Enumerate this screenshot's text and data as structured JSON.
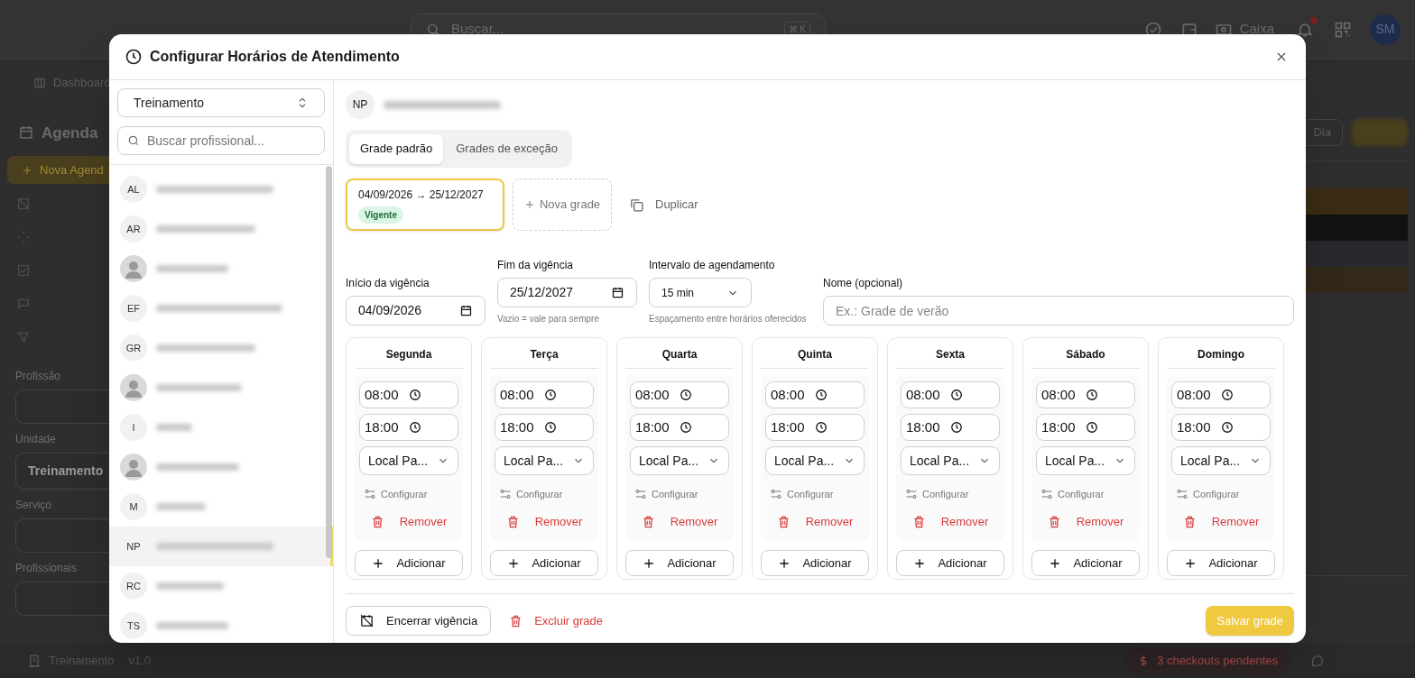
{
  "app": {
    "search_placeholder": "Buscar...",
    "search_shortcut": "⌘ K",
    "cash_label": "Caixa",
    "user_initials": "SM",
    "breadcrumb": "Dashboard",
    "page_title": "Agenda",
    "new_button": "Nova Agend",
    "view_button": "Dia",
    "filters": [
      {
        "label": "Profissão"
      },
      {
        "label": "Unidade",
        "value": "Treinamento"
      },
      {
        "label": "Serviço"
      },
      {
        "label": "Profissionais"
      }
    ],
    "footer": {
      "unit": "Treinamento",
      "version": "v1.0",
      "checkouts": "3 checkouts pendentes"
    }
  },
  "modal": {
    "title": "Configurar Horários de Atendimento",
    "unit_select": "Treinamento",
    "search_placeholder": "Buscar profissional...",
    "professionals": [
      {
        "kind": "initials",
        "initials": "AL",
        "selected": false
      },
      {
        "kind": "initials",
        "initials": "AR",
        "selected": false
      },
      {
        "kind": "photo",
        "selected": false
      },
      {
        "kind": "initials",
        "initials": "EF",
        "selected": false
      },
      {
        "kind": "initials",
        "initials": "GR",
        "selected": false
      },
      {
        "kind": "photo",
        "selected": false
      },
      {
        "kind": "initials",
        "initials": "I",
        "selected": false
      },
      {
        "kind": "photo",
        "selected": false
      },
      {
        "kind": "initials",
        "initials": "M",
        "selected": false
      },
      {
        "kind": "initials",
        "initials": "NP",
        "selected": true
      },
      {
        "kind": "initials",
        "initials": "RC",
        "selected": false
      },
      {
        "kind": "initials",
        "initials": "TS",
        "selected": false
      }
    ],
    "current_initials": "NP",
    "tabs": [
      {
        "label": "Grade padrão",
        "selected": true
      },
      {
        "label": "Grades de exceção",
        "selected": false
      }
    ],
    "schedules": [
      {
        "range": "04/09/2026 → 25/12/2027",
        "badge": "Vigente",
        "selected": true
      }
    ],
    "new_schedule": "Nova grade",
    "duplicate": "Duplicar",
    "start": {
      "label": "Início da vigência",
      "value": "04/09/2026"
    },
    "end": {
      "label": "Fim da vigência",
      "value": "25/12/2027",
      "hint": "Vazio = vale para sempre"
    },
    "interval": {
      "label": "Intervalo de agendamento",
      "value": "15 min",
      "hint": "Espaçamento entre horários oferecidos"
    },
    "name": {
      "label": "Nome (opcional)",
      "placeholder": "Ex.: Grade de verão"
    },
    "days": [
      {
        "name": "Segunda",
        "slots": [
          {
            "start": "08:00",
            "end": "18:00",
            "location": "Local Pa...",
            "configure": "Configurar",
            "remove": "Remover"
          }
        ],
        "add": "Adicionar"
      },
      {
        "name": "Terça",
        "slots": [
          {
            "start": "08:00",
            "end": "18:00",
            "location": "Local Pa...",
            "configure": "Configurar",
            "remove": "Remover"
          }
        ],
        "add": "Adicionar"
      },
      {
        "name": "Quarta",
        "slots": [
          {
            "start": "08:00",
            "end": "18:00",
            "location": "Local Pa...",
            "configure": "Configurar",
            "remove": "Remover"
          }
        ],
        "add": "Adicionar"
      },
      {
        "name": "Quinta",
        "slots": [
          {
            "start": "08:00",
            "end": "18:00",
            "location": "Local Pa...",
            "configure": "Configurar",
            "remove": "Remover"
          }
        ],
        "add": "Adicionar"
      },
      {
        "name": "Sexta",
        "slots": [
          {
            "start": "08:00",
            "end": "18:00",
            "location": "Local Pa...",
            "configure": "Configurar",
            "remove": "Remover"
          }
        ],
        "add": "Adicionar"
      },
      {
        "name": "Sábado",
        "slots": [
          {
            "start": "08:00",
            "end": "18:00",
            "location": "Local Pa...",
            "configure": "Configurar",
            "remove": "Remover"
          }
        ],
        "add": "Adicionar"
      },
      {
        "name": "Domingo",
        "slots": [
          {
            "start": "08:00",
            "end": "18:00",
            "location": "Local Pa...",
            "configure": "Configurar",
            "remove": "Remover"
          }
        ],
        "add": "Adicionar"
      }
    ],
    "end_button": "Encerrar vigência",
    "delete_button": "Excluir grade",
    "save_button": "Salvar grade"
  }
}
